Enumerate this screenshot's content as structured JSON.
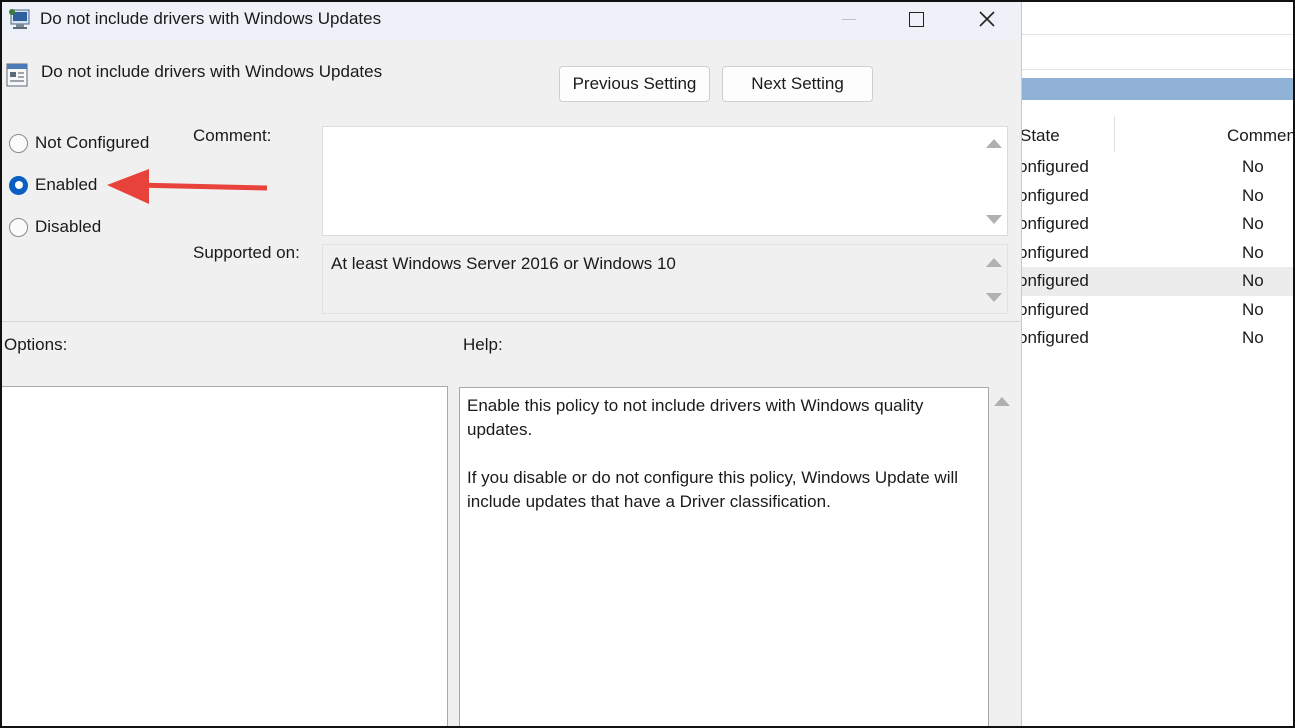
{
  "dialog": {
    "title": "Do not include drivers with Windows Updates",
    "policy_name": "Do not include drivers with Windows Updates",
    "prev_button": "Previous Setting",
    "next_button": "Next Setting",
    "radio": {
      "not_configured": "Not Configured",
      "enabled": "Enabled",
      "disabled": "Disabled",
      "selected": "enabled"
    },
    "comment_label": "Comment:",
    "comment_value": "",
    "supported_label": "Supported on:",
    "supported_value": "At least Windows Server 2016 or Windows 10",
    "options_label": "Options:",
    "help_label": "Help:",
    "help_paragraphs": [
      "Enable this policy to not include drivers with Windows quality updates.",
      "If you disable or do not configure this policy, Windows Update will include updates that have a Driver classification."
    ]
  },
  "background_list": {
    "columns": [
      "State",
      "Commen"
    ],
    "rows": [
      {
        "state": "onfigured",
        "comment": "No"
      },
      {
        "state": "onfigured",
        "comment": "No"
      },
      {
        "state": "onfigured",
        "comment": "No"
      },
      {
        "state": "onfigured",
        "comment": "No"
      },
      {
        "state": "onfigured",
        "comment": "No"
      },
      {
        "state": "onfigured",
        "comment": "No"
      },
      {
        "state": "onfigured",
        "comment": "No"
      }
    ],
    "selected_row": 4
  },
  "colors": {
    "accent": "#0a5fc2",
    "annotation_arrow": "#e8433a",
    "header_bar": "#8fb2d6"
  },
  "icons": {
    "title": "group-policy-icon",
    "policy": "policy-setting-icon",
    "annotation": "red-arrow-pointer"
  }
}
